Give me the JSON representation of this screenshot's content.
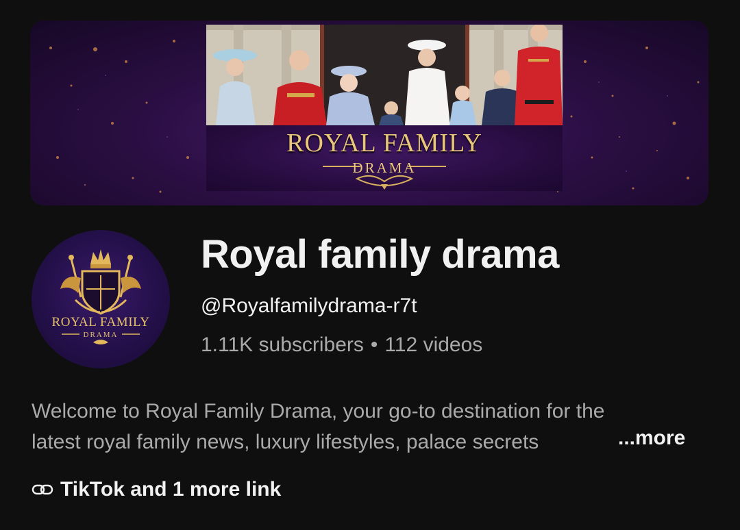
{
  "banner": {
    "title": "ROYAL FAMILY",
    "subtitle": "DRAMA",
    "image": "royal-family-balcony-photo"
  },
  "avatar": {
    "title": "ROYAL FAMILY",
    "subtitle": "DRAMA",
    "icon": "crown-crest-icon"
  },
  "channel": {
    "name": "Royal family drama",
    "handle": "@Royalfamilydrama-r7t",
    "subscribers": "1.11K subscribers",
    "separator": "•",
    "videos": "112 videos"
  },
  "description": {
    "line1": "Welcome to Royal Family Drama, your go-to destination for the",
    "line2": "latest royal family news, luxury lifestyles, palace secrets",
    "more_label": "...more"
  },
  "links": {
    "icon": "link-icon",
    "label": "TikTok and 1 more link"
  },
  "colors": {
    "background": "#0f0f0f",
    "primary_text": "#f1f1f1",
    "secondary_text": "#aaaaaa",
    "gold": "#e9c77a",
    "purple": "#2c0f45"
  }
}
